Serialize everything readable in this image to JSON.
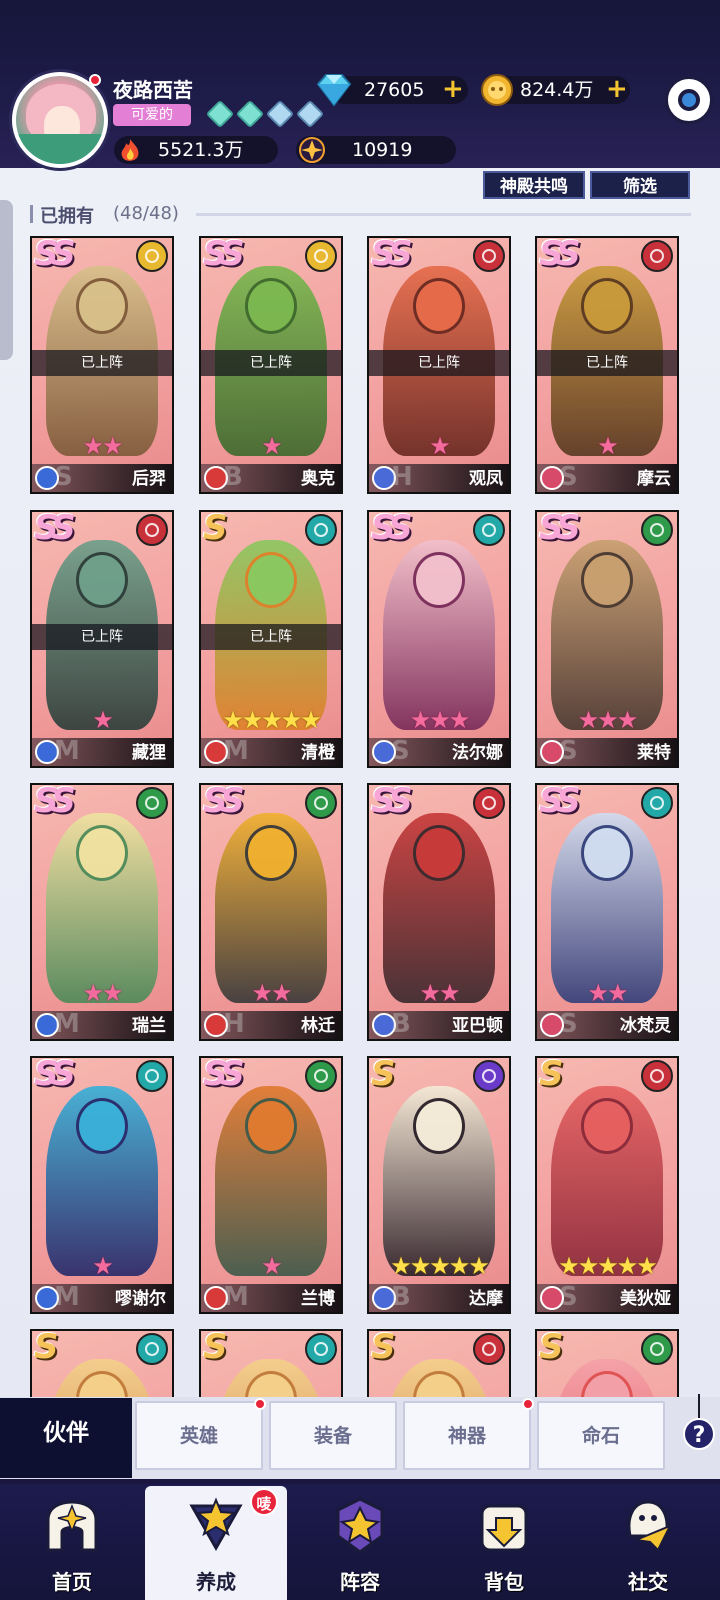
{
  "header": {
    "player_name": "夜路西苦",
    "player_title": "可爱的",
    "diamonds": "27605",
    "gold": "824.4万",
    "power": "5521.3万",
    "stardust": "10919"
  },
  "toolbar": {
    "resonance_label": "神殿共鸣",
    "filter_label": "筛选"
  },
  "section": {
    "title": "已拥有",
    "count": "(48/48)"
  },
  "status_deployed": "已上阵",
  "heroes": [
    {
      "name": "后羿",
      "rank": "SS",
      "stars": "★★",
      "deployed": true,
      "faction": "light",
      "class_letter": "S",
      "colors": [
        "#d8c08a",
        "#7e5a3a"
      ]
    },
    {
      "name": "奥克",
      "rank": "SS",
      "stars": "★",
      "deployed": true,
      "faction": "light",
      "class_letter": "B",
      "colors": [
        "#7cb850",
        "#3f6a2e"
      ]
    },
    {
      "name": "观凤",
      "rank": "SS",
      "stars": "★",
      "deployed": true,
      "faction": "fire",
      "class_letter": "H",
      "colors": [
        "#e66b4a",
        "#6a2a22"
      ]
    },
    {
      "name": "摩云",
      "rank": "SS",
      "stars": "★",
      "deployed": true,
      "faction": "fire",
      "class_letter": "S",
      "colors": [
        "#c89a3a",
        "#5a3a22"
      ]
    },
    {
      "name": "藏狸",
      "rank": "SS",
      "stars": "★",
      "deployed": true,
      "faction": "fire",
      "class_letter": "M",
      "colors": [
        "#6fa08a",
        "#2e3e3a"
      ]
    },
    {
      "name": "清橙",
      "rank": "S",
      "stars": "★★★★★",
      "deployed": true,
      "faction": "water",
      "class_letter": "M",
      "colors": [
        "#8ac860",
        "#e0802a"
      ]
    },
    {
      "name": "法尔娜",
      "rank": "SS",
      "stars": "★★★",
      "deployed": false,
      "faction": "water",
      "class_letter": "S",
      "colors": [
        "#f2c0cc",
        "#7a2c5a"
      ]
    },
    {
      "name": "莱特",
      "rank": "SS",
      "stars": "★★★",
      "deployed": false,
      "faction": "nature",
      "class_letter": "S",
      "colors": [
        "#c8a070",
        "#4a3a32"
      ]
    },
    {
      "name": "瑞兰",
      "rank": "SS",
      "stars": "★★",
      "deployed": false,
      "faction": "nature",
      "class_letter": "M",
      "colors": [
        "#f0e2a0",
        "#4e8a5a"
      ]
    },
    {
      "name": "林迁",
      "rank": "SS",
      "stars": "★★",
      "deployed": false,
      "faction": "nature",
      "class_letter": "H",
      "colors": [
        "#f0b030",
        "#3a3a3a"
      ]
    },
    {
      "name": "亚巴顿",
      "rank": "SS",
      "stars": "★★",
      "deployed": false,
      "faction": "fire",
      "class_letter": "B",
      "colors": [
        "#c83a3a",
        "#3a2a2e"
      ]
    },
    {
      "name": "冰梵灵",
      "rank": "SS",
      "stars": "★★",
      "deployed": false,
      "faction": "water",
      "class_letter": "S",
      "colors": [
        "#d0dcf0",
        "#34407a"
      ]
    },
    {
      "name": "嘐谢尔",
      "rank": "SS",
      "stars": "★",
      "deployed": false,
      "faction": "water",
      "class_letter": "M",
      "colors": [
        "#3ab0d8",
        "#2a2a6a"
      ]
    },
    {
      "name": "兰博",
      "rank": "SS",
      "stars": "★",
      "deployed": false,
      "faction": "nature",
      "class_letter": "M",
      "colors": [
        "#e07a30",
        "#3e5a4a"
      ]
    },
    {
      "name": "达摩",
      "rank": "S",
      "stars": "★★★★★",
      "deployed": false,
      "faction": "dark",
      "class_letter": "B",
      "colors": [
        "#f4ecd8",
        "#2a2028"
      ]
    },
    {
      "name": "美狄娅",
      "rank": "S",
      "stars": "★★★★★",
      "deployed": false,
      "faction": "fire",
      "class_letter": "S",
      "colors": [
        "#e66060",
        "#8a2a3a"
      ]
    },
    {
      "name": "",
      "rank": "S",
      "stars": "",
      "deployed": false,
      "faction": "water",
      "class_letter": "",
      "colors": [
        "#f4d08a",
        "#c07a3a"
      ]
    },
    {
      "name": "",
      "rank": "S",
      "stars": "",
      "deployed": false,
      "faction": "water",
      "class_letter": "",
      "colors": [
        "#f4d08a",
        "#c07a3a"
      ]
    },
    {
      "name": "",
      "rank": "S",
      "stars": "",
      "deployed": false,
      "faction": "fire",
      "class_letter": "",
      "colors": [
        "#f4d08a",
        "#c07a3a"
      ]
    },
    {
      "name": "",
      "rank": "S",
      "stars": "",
      "deployed": false,
      "faction": "nature",
      "class_letter": "",
      "colors": [
        "#f4a0a8",
        "#e05050"
      ]
    }
  ],
  "faction_colors": {
    "light": "#e8b830",
    "fire": "#c8303a",
    "water": "#23a8a8",
    "nature": "#2e9a4a",
    "dark": "#6a3ac8"
  },
  "tabs": {
    "active": "伙伴",
    "hero": "英雄",
    "equipment": "装备",
    "artifact": "神器",
    "fate_stone": "命石",
    "help": "?"
  },
  "nav": {
    "home": "首页",
    "train": "养成",
    "train_badge": "唛",
    "lineup": "阵容",
    "bag": "背包",
    "social": "社交"
  }
}
